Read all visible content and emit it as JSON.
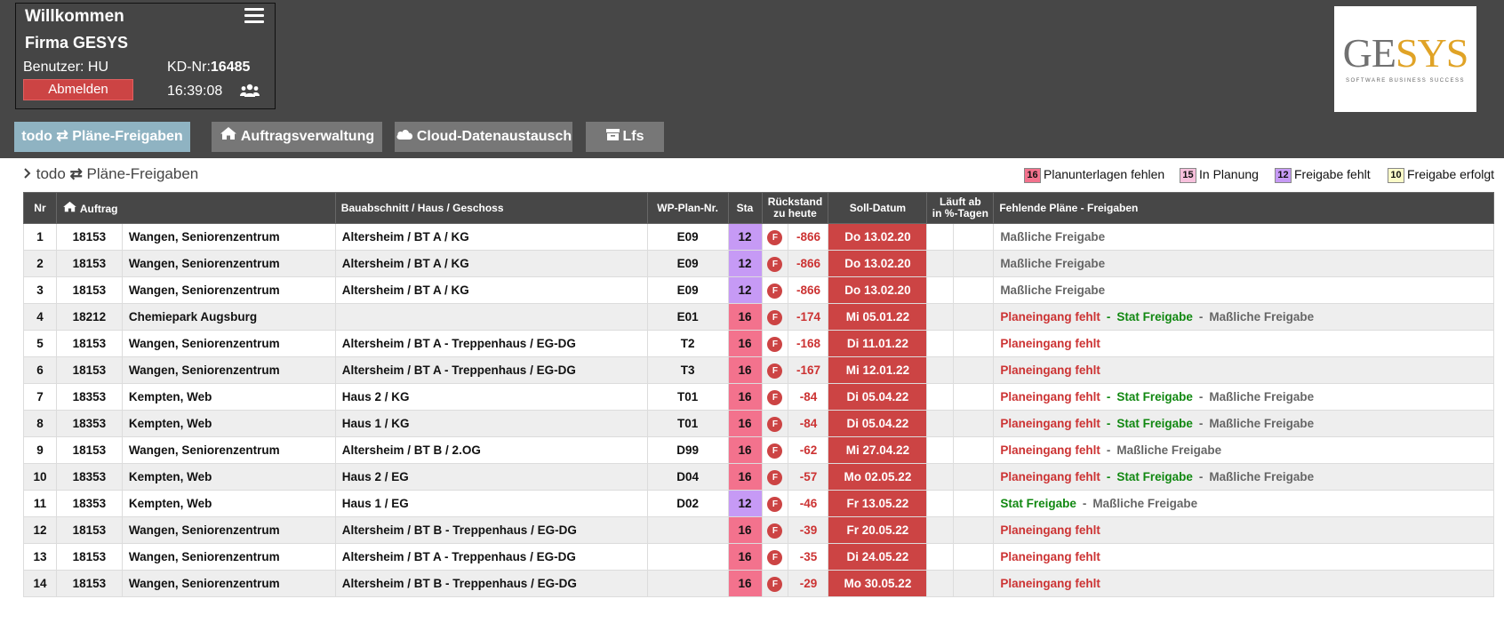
{
  "header": {
    "welcome": "Willkommen",
    "company": "Firma GESYS",
    "user_label": "Benutzer:  HU",
    "kd_label": "KD-Nr:",
    "kd_value": "16485",
    "logout_label": "Abmelden",
    "time": "16:39:08"
  },
  "logo": {
    "part1": "GE",
    "part2": "SYS",
    "tagline": "SOFTWARE  BUSINESS  SUCCESS"
  },
  "tabs": [
    {
      "label": "todo ⇄ Pläne-Freigaben",
      "active": true
    },
    {
      "label": "Auftragsverwaltung",
      "icon": "home-icon"
    },
    {
      "label": "Cloud-Datenaustausch",
      "icon": "cloud-icon"
    },
    {
      "label": "Lfs",
      "icon": "archive-icon"
    }
  ],
  "breadcrumb": {
    "text": "todo",
    "page": "Pläne-Freigaben"
  },
  "legend": [
    {
      "num": "16",
      "label": "Planunterlagen fehlen",
      "color": "#f3728d"
    },
    {
      "num": "15",
      "label": "In Planung",
      "color": "#f7c0dc"
    },
    {
      "num": "12",
      "label": "Freigabe fehlt",
      "color": "#c69af5"
    },
    {
      "num": "10",
      "label": "Freigabe erfolgt",
      "color": "#fbfbc8"
    }
  ],
  "columns": {
    "nr": "Nr",
    "auftrag": "Auftrag",
    "bau": "Bauabschnitt / Haus / Geschoss",
    "wp": "WP-Plan-Nr.",
    "sta": "Sta",
    "rueck1": "Rückstand",
    "rueck2": "zu heute",
    "soll": "Soll-Datum",
    "lauf1": "Läuft ab",
    "lauf2": "in %-Tagen",
    "fehl": "Fehlende Pläne - Freigaben"
  },
  "rows": [
    {
      "nr": "1",
      "auftrag": "18153",
      "name": "Wangen, Seniorenzentrum",
      "bau": "Altersheim / BT A / KG",
      "wp": "E09",
      "sta": "12",
      "badge": "F",
      "rueck": "-866",
      "soll": "Do 13.02.20",
      "missing": [
        {
          "t": "Maßliche Freigabe",
          "c": "grey"
        }
      ]
    },
    {
      "nr": "2",
      "auftrag": "18153",
      "name": "Wangen, Seniorenzentrum",
      "bau": "Altersheim / BT A / KG",
      "wp": "E09",
      "sta": "12",
      "badge": "F",
      "rueck": "-866",
      "soll": "Do 13.02.20",
      "missing": [
        {
          "t": "Maßliche Freigabe",
          "c": "grey"
        }
      ]
    },
    {
      "nr": "3",
      "auftrag": "18153",
      "name": "Wangen, Seniorenzentrum",
      "bau": "Altersheim / BT A / KG",
      "wp": "E09",
      "sta": "12",
      "badge": "F",
      "rueck": "-866",
      "soll": "Do 13.02.20",
      "missing": [
        {
          "t": "Maßliche Freigabe",
          "c": "grey"
        }
      ]
    },
    {
      "nr": "4",
      "auftrag": "18212",
      "name": "Chemiepark Augsburg",
      "bau": "",
      "wp": "E01",
      "sta": "16",
      "badge": "F",
      "rueck": "-174",
      "soll": "Mi 05.01.22",
      "missing": [
        {
          "t": "Planeingang fehlt",
          "c": "red"
        },
        {
          "t": "Stat Freigabe",
          "c": "green"
        },
        {
          "t": "Maßliche Freigabe",
          "c": "grey"
        }
      ]
    },
    {
      "nr": "5",
      "auftrag": "18153",
      "name": "Wangen, Seniorenzentrum",
      "bau": "Altersheim / BT A - Treppenhaus / EG-DG",
      "wp": "T2",
      "sta": "16",
      "badge": "F",
      "rueck": "-168",
      "soll": "Di 11.01.22",
      "missing": [
        {
          "t": "Planeingang fehlt",
          "c": "red"
        }
      ]
    },
    {
      "nr": "6",
      "auftrag": "18153",
      "name": "Wangen, Seniorenzentrum",
      "bau": "Altersheim / BT A - Treppenhaus / EG-DG",
      "wp": "T3",
      "sta": "16",
      "badge": "F",
      "rueck": "-167",
      "soll": "Mi 12.01.22",
      "missing": [
        {
          "t": "Planeingang fehlt",
          "c": "red"
        }
      ]
    },
    {
      "nr": "7",
      "auftrag": "18353",
      "name": "Kempten, Web",
      "bau": "Haus 2 / KG",
      "wp": "T01",
      "sta": "16",
      "badge": "F",
      "rueck": "-84",
      "soll": "Di 05.04.22",
      "missing": [
        {
          "t": "Planeingang fehlt",
          "c": "red"
        },
        {
          "t": "Stat Freigabe",
          "c": "green"
        },
        {
          "t": "Maßliche Freigabe",
          "c": "grey"
        }
      ]
    },
    {
      "nr": "8",
      "auftrag": "18353",
      "name": "Kempten, Web",
      "bau": "Haus 1 / KG",
      "wp": "T01",
      "sta": "16",
      "badge": "F",
      "rueck": "-84",
      "soll": "Di 05.04.22",
      "missing": [
        {
          "t": "Planeingang fehlt",
          "c": "red"
        },
        {
          "t": "Stat Freigabe",
          "c": "green"
        },
        {
          "t": "Maßliche Freigabe",
          "c": "grey"
        }
      ]
    },
    {
      "nr": "9",
      "auftrag": "18153",
      "name": "Wangen, Seniorenzentrum",
      "bau": "Altersheim / BT B / 2.OG",
      "wp": "D99",
      "sta": "16",
      "badge": "F",
      "rueck": "-62",
      "soll": "Mi 27.04.22",
      "missing": [
        {
          "t": "Planeingang fehlt",
          "c": "red"
        },
        {
          "t": "Maßliche Freigabe",
          "c": "grey"
        }
      ]
    },
    {
      "nr": "10",
      "auftrag": "18353",
      "name": "Kempten, Web",
      "bau": "Haus 2 / EG",
      "wp": "D04",
      "sta": "16",
      "badge": "F",
      "rueck": "-57",
      "soll": "Mo 02.05.22",
      "missing": [
        {
          "t": "Planeingang fehlt",
          "c": "red"
        },
        {
          "t": "Stat Freigabe",
          "c": "green"
        },
        {
          "t": "Maßliche Freigabe",
          "c": "grey"
        }
      ]
    },
    {
      "nr": "11",
      "auftrag": "18353",
      "name": "Kempten, Web",
      "bau": "Haus 1 / EG",
      "wp": "D02",
      "sta": "12",
      "badge": "F",
      "rueck": "-46",
      "soll": "Fr 13.05.22",
      "missing": [
        {
          "t": "Stat Freigabe",
          "c": "green"
        },
        {
          "t": "Maßliche Freigabe",
          "c": "grey"
        }
      ]
    },
    {
      "nr": "12",
      "auftrag": "18153",
      "name": "Wangen, Seniorenzentrum",
      "bau": "Altersheim / BT B - Treppenhaus / EG-DG",
      "wp": "",
      "sta": "16",
      "badge": "F",
      "rueck": "-39",
      "soll": "Fr 20.05.22",
      "missing": [
        {
          "t": "Planeingang fehlt",
          "c": "red"
        }
      ]
    },
    {
      "nr": "13",
      "auftrag": "18153",
      "name": "Wangen, Seniorenzentrum",
      "bau": "Altersheim / BT A - Treppenhaus / EG-DG",
      "wp": "",
      "sta": "16",
      "badge": "F",
      "rueck": "-35",
      "soll": "Di 24.05.22",
      "missing": [
        {
          "t": "Planeingang fehlt",
          "c": "red"
        }
      ]
    },
    {
      "nr": "14",
      "auftrag": "18153",
      "name": "Wangen, Seniorenzentrum",
      "bau": "Altersheim / BT B - Treppenhaus / EG-DG",
      "wp": "",
      "sta": "16",
      "badge": "F",
      "rueck": "-29",
      "soll": "Mo 30.05.22",
      "missing": [
        {
          "t": "Planeingang fehlt",
          "c": "red"
        }
      ]
    }
  ]
}
